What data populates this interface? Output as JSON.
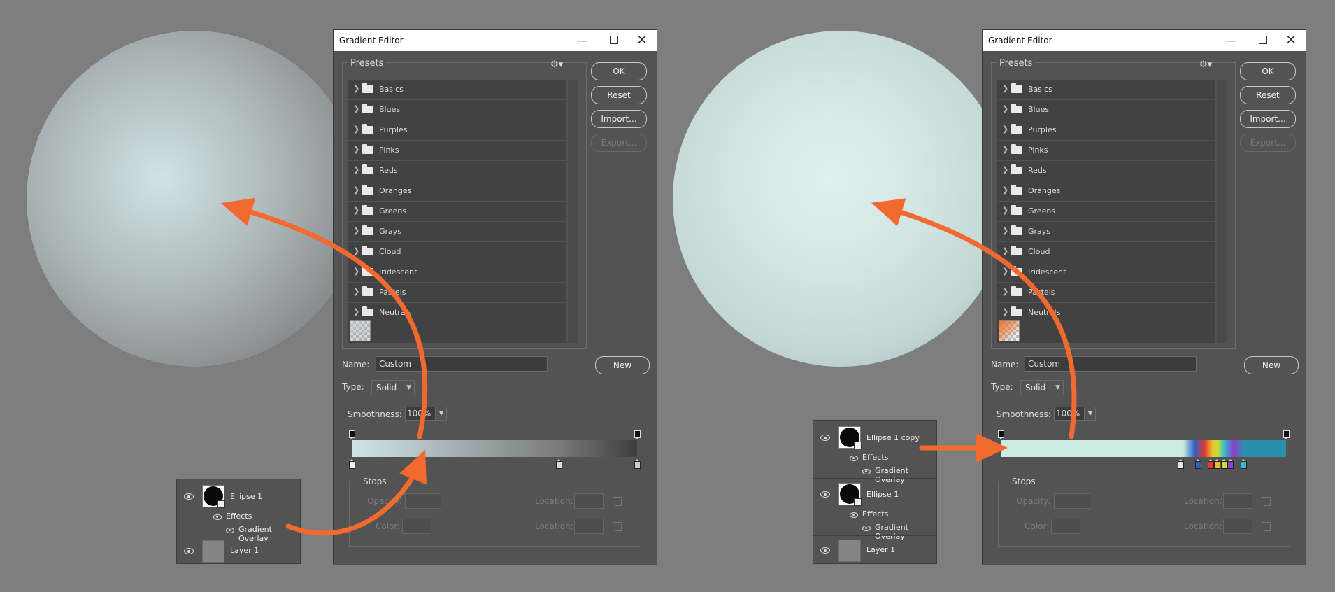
{
  "dialog": {
    "title": "Gradient Editor",
    "presets_label": "Presets",
    "buttons": {
      "ok": "OK",
      "reset": "Reset",
      "import": "Import...",
      "export": "Export...",
      "new": "New"
    },
    "name_label": "Name:",
    "name_value": "Custom",
    "type_label": "Type:",
    "type_value": "Solid",
    "smoothness_label": "Smoothness:",
    "smoothness_value": "100%",
    "stops_label": "Stops",
    "opacity_label": "Opacity:",
    "color_label": "Color:",
    "location_label": "Location:"
  },
  "presets": [
    {
      "label": "Basics"
    },
    {
      "label": "Blues"
    },
    {
      "label": "Purples"
    },
    {
      "label": "Pinks"
    },
    {
      "label": "Reds"
    },
    {
      "label": "Oranges"
    },
    {
      "label": "Greens"
    },
    {
      "label": "Grays"
    },
    {
      "label": "Cloud"
    },
    {
      "label": "Iridescent"
    },
    {
      "label": "Pastels"
    },
    {
      "label": "Neutrals"
    }
  ],
  "layers_left": {
    "ellipse": "Ellipse 1",
    "effects": "Effects",
    "overlay": "Gradient Overlay",
    "layer": "Layer 1"
  },
  "layers_right": {
    "ellipse_copy": "Ellipse 1 copy",
    "effects": "Effects",
    "overlay": "Gradient Overlay",
    "ellipse": "Ellipse 1",
    "effects2": "Effects",
    "overlay2": "Gradient Overlay",
    "layer": "Layer 1"
  },
  "gradient_left": {
    "color_stops": [
      0.0,
      0.725,
      1.0
    ],
    "opacity_stops": [
      0.0,
      1.0
    ]
  },
  "gradient_right": {
    "color_stops": [
      0.63,
      0.69,
      0.735,
      0.758,
      0.782,
      0.805,
      0.85
    ],
    "opacity_stops": [
      0.0,
      1.0
    ]
  },
  "colors": {
    "accent_arrow": "#f26a30",
    "dialog_bg": "#535353",
    "canvas_bg": "#7e7e7e"
  }
}
